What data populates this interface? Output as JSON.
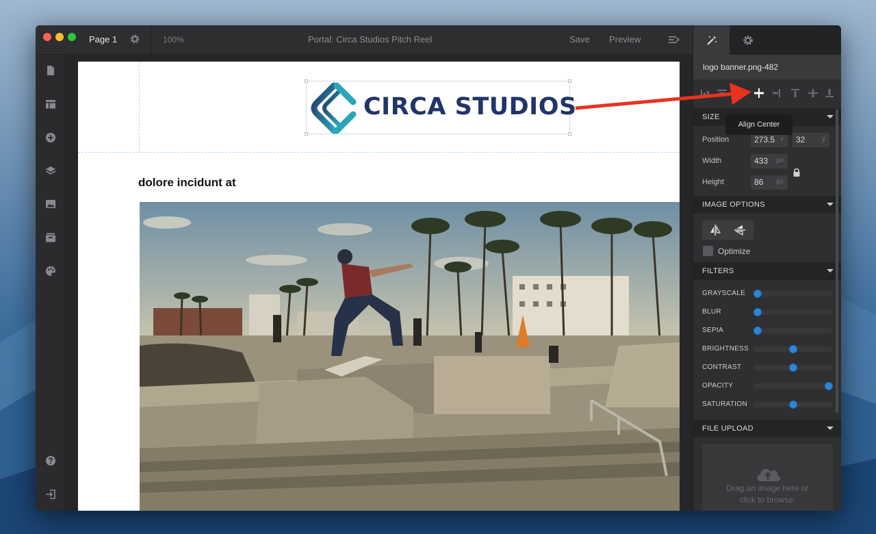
{
  "window": {
    "page_name": "Page 1",
    "zoom": "100%",
    "doc_title": "Portal: Circa Studios Pitch Reel",
    "save_label": "Save",
    "preview_label": "Preview"
  },
  "sidebar": {
    "icons": [
      "page-icon",
      "layout-icon",
      "add-icon",
      "layers-icon",
      "image-icon",
      "archive-icon",
      "palette-icon"
    ],
    "bottom_icons": [
      "help-icon",
      "exit-icon"
    ]
  },
  "canvas": {
    "logo_text": "CIRCA STUDIOS",
    "heading": "dolore incidunt at"
  },
  "panel": {
    "tabs": [
      "magic-wand-icon",
      "gear-icon"
    ],
    "filename": "logo banner.png-482",
    "tooltip": "Align Center",
    "size": {
      "title": "SIZE",
      "position_label": "Position",
      "position_x": "273.5",
      "position_x_unit": "x",
      "position_y": "32",
      "position_y_unit": "y",
      "width_label": "Width",
      "width": "433",
      "width_unit": "px",
      "height_label": "Height",
      "height": "86",
      "height_unit": "px"
    },
    "image_options": {
      "title": "IMAGE OPTIONS",
      "optimize_label": "Optimize",
      "optimize_checked": false
    },
    "filters": {
      "title": "FILTERS",
      "items": [
        {
          "label": "GRAYSCALE",
          "value": 0
        },
        {
          "label": "BLUR",
          "value": 0
        },
        {
          "label": "SEPIA",
          "value": 0
        },
        {
          "label": "BRIGHTNESS",
          "value": 0.5
        },
        {
          "label": "CONTRAST",
          "value": 0.5
        },
        {
          "label": "OPACITY",
          "value": 1
        },
        {
          "label": "SATURATION",
          "value": 0.5
        }
      ]
    },
    "file_upload": {
      "title": "FILE UPLOAD",
      "line1": "Drag an image here or",
      "line2": "click to browse."
    }
  },
  "colors": {
    "accent": "#2d86d6",
    "arrow": "#e8331e",
    "logo_navy": "#223568",
    "logo_teal": "#2aa6b8"
  }
}
